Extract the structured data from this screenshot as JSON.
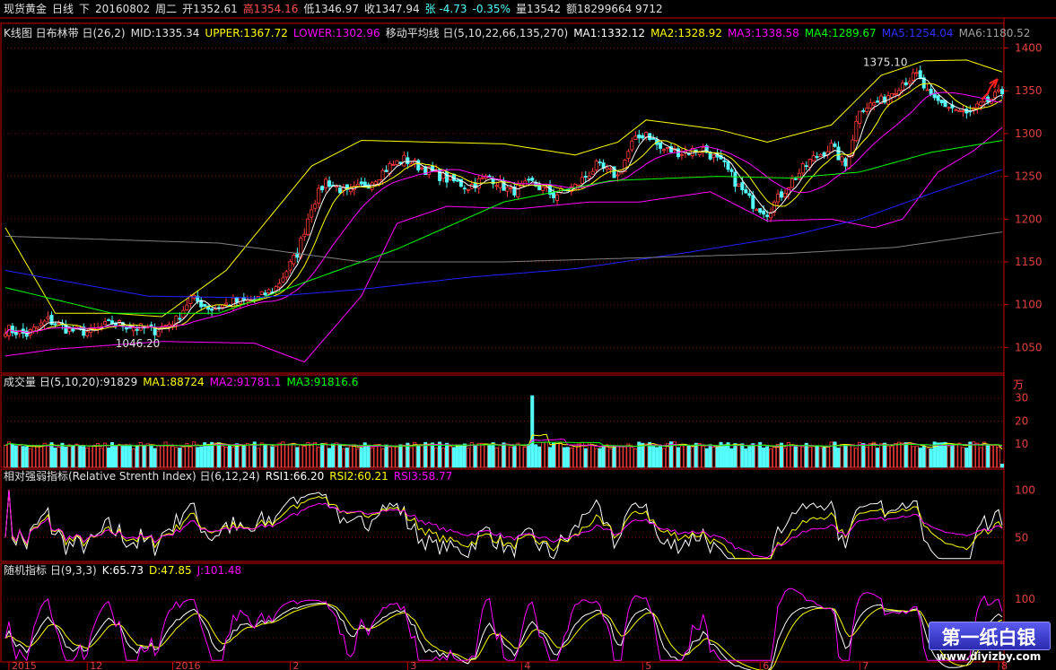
{
  "top_bar": {
    "symbol": "现货黄金",
    "period": "日线",
    "dir": "下",
    "date": "20160802",
    "weekday": "周二",
    "open": "开1352.61",
    "high": "高1354.16",
    "low": "低1346.97",
    "close": "收1347.94",
    "change": "张 -4.73",
    "change_pct": "-0.35%",
    "volume": "量13542",
    "amount": "额18299664 9712"
  },
  "kline_bar": {
    "title": "K线图 日布林带 日(26,2)",
    "mid": "MID:1335.34",
    "upper": "UPPER:1367.72",
    "lower": "LOWER:1302.96",
    "ma_title": "移动平均线 日(5,10,22,66,135,270)",
    "ma1": "MA1:1332.12",
    "ma2": "MA2:1328.92",
    "ma3": "MA3:1338.58",
    "ma4": "MA4:1289.67",
    "ma5": "MA5:1254.04",
    "ma6": "MA6:1180.52"
  },
  "vol_bar": {
    "title": "成交量 日(5,10,20)",
    "value": ":91829",
    "ma1": "MA1:88724",
    "ma2": "MA2:91781.1",
    "ma3": "MA3:91816.6",
    "unit": "万"
  },
  "rsi_bar": {
    "title": "相对强弱指标(Relative Strenth Index) 日(6,12,24)",
    "rsi1": "RSI1:66.20",
    "rsi2": "RSI2:60.21",
    "rsi3": "RSI3:58.77"
  },
  "kdj_bar": {
    "title": "随机指标 日(9,3,3)",
    "k": "K:65.73",
    "d": "D:47.85",
    "j": "J:101.48"
  },
  "watermark": {
    "line1": "第一纸白银",
    "line2": "www.diyizby.com"
  },
  "colors": {
    "up": "#ff3b3b",
    "down": "#54fcfc",
    "grid": "#8b0000",
    "axis": "#c80000",
    "ma1": "#ffffff",
    "ma2": "#ffff00",
    "ma3": "#ff00ff",
    "ma4": "#00ff00",
    "ma5": "#2020ff",
    "ma6": "#808080",
    "boll": "#ffff00"
  },
  "chart_data": [
    {
      "type": "candlestick",
      "title": "",
      "ylim": [
        1020,
        1410
      ],
      "yticks": [
        1400,
        1350,
        1300,
        1250,
        1200,
        1150,
        1100,
        1050
      ],
      "xticks": [
        "2015",
        "12",
        "2016",
        "2",
        "3",
        "4",
        "5",
        "6",
        "7",
        "8"
      ],
      "annotations": [
        {
          "text": "1375.10",
          "y": 1375.1
        },
        {
          "text": "1046.20",
          "y": 1046.2
        }
      ],
      "anchors": [
        [
          0,
          1072
        ],
        [
          6,
          1065
        ],
        [
          12,
          1082
        ],
        [
          18,
          1070
        ],
        [
          24,
          1068
        ],
        [
          30,
          1079
        ],
        [
          36,
          1074
        ],
        [
          42,
          1070
        ],
        [
          48,
          1082
        ],
        [
          52,
          1108
        ],
        [
          58,
          1095
        ],
        [
          64,
          1103
        ],
        [
          70,
          1105
        ],
        [
          76,
          1120
        ],
        [
          82,
          1160
        ],
        [
          86,
          1215
        ],
        [
          90,
          1245
        ],
        [
          96,
          1230
        ],
        [
          102,
          1242
        ],
        [
          108,
          1262
        ],
        [
          112,
          1270
        ],
        [
          118,
          1258
        ],
        [
          124,
          1247
        ],
        [
          130,
          1238
        ],
        [
          136,
          1250
        ],
        [
          142,
          1232
        ],
        [
          148,
          1242
        ],
        [
          154,
          1228
        ],
        [
          160,
          1238
        ],
        [
          166,
          1262
        ],
        [
          172,
          1250
        ],
        [
          176,
          1288
        ],
        [
          180,
          1302
        ],
        [
          184,
          1282
        ],
        [
          190,
          1278
        ],
        [
          196,
          1282
        ],
        [
          202,
          1262
        ],
        [
          206,
          1238
        ],
        [
          210,
          1218
        ],
        [
          214,
          1208
        ],
        [
          220,
          1240
        ],
        [
          226,
          1268
        ],
        [
          232,
          1285
        ],
        [
          236,
          1262
        ],
        [
          240,
          1330
        ],
        [
          246,
          1338
        ],
        [
          252,
          1360
        ],
        [
          256,
          1368
        ],
        [
          260,
          1340
        ],
        [
          266,
          1330
        ],
        [
          270,
          1322
        ],
        [
          276,
          1338
        ],
        [
          280,
          1348
        ]
      ],
      "bands": {
        "upper": [
          [
            0,
            1190
          ],
          [
            14,
            1090
          ],
          [
            30,
            1090
          ],
          [
            44,
            1086
          ],
          [
            62,
            1140
          ],
          [
            86,
            1262
          ],
          [
            100,
            1292
          ],
          [
            120,
            1290
          ],
          [
            140,
            1288
          ],
          [
            160,
            1275
          ],
          [
            172,
            1290
          ],
          [
            180,
            1316
          ],
          [
            200,
            1305
          ],
          [
            214,
            1290
          ],
          [
            232,
            1310
          ],
          [
            246,
            1368
          ],
          [
            258,
            1385
          ],
          [
            270,
            1386
          ],
          [
            280,
            1372
          ]
        ],
        "lower": [
          [
            0,
            1040
          ],
          [
            14,
            1048
          ],
          [
            44,
            1057
          ],
          [
            70,
            1055
          ],
          [
            84,
            1033
          ],
          [
            100,
            1110
          ],
          [
            110,
            1195
          ],
          [
            124,
            1215
          ],
          [
            144,
            1212
          ],
          [
            164,
            1220
          ],
          [
            178,
            1220
          ],
          [
            198,
            1232
          ],
          [
            214,
            1198
          ],
          [
            232,
            1200
          ],
          [
            244,
            1190
          ],
          [
            252,
            1200
          ],
          [
            262,
            1255
          ],
          [
            272,
            1280
          ],
          [
            280,
            1307
          ]
        ]
      },
      "ma_lines": [
        {
          "name": "MA4",
          "points": [
            [
              0,
              1120
            ],
            [
              30,
              1090
            ],
            [
              60,
              1090
            ],
            [
              90,
              1135
            ],
            [
              110,
              1165
            ],
            [
              140,
              1220
            ],
            [
              170,
              1245
            ],
            [
              200,
              1250
            ],
            [
              220,
              1248
            ],
            [
              240,
              1255
            ],
            [
              260,
              1278
            ],
            [
              280,
              1292
            ]
          ]
        },
        {
          "name": "MA5",
          "points": [
            [
              0,
              1140
            ],
            [
              40,
              1110
            ],
            [
              70,
              1108
            ],
            [
              100,
              1118
            ],
            [
              130,
              1132
            ],
            [
              160,
              1142
            ],
            [
              190,
              1160
            ],
            [
              220,
              1180
            ],
            [
              240,
              1200
            ],
            [
              260,
              1230
            ],
            [
              280,
              1258
            ]
          ]
        },
        {
          "name": "MA6",
          "points": [
            [
              0,
              1180
            ],
            [
              60,
              1172
            ],
            [
              100,
              1150
            ],
            [
              140,
              1150
            ],
            [
              180,
              1155
            ],
            [
              220,
              1160
            ],
            [
              250,
              1167
            ],
            [
              280,
              1185
            ]
          ]
        }
      ]
    },
    {
      "type": "bar",
      "title": "",
      "unit": "万",
      "ylim": [
        0,
        33
      ],
      "yticks": [
        30,
        20,
        10
      ],
      "spike": {
        "index": 148,
        "value": 31
      }
    },
    {
      "type": "line",
      "title": "",
      "ylim": [
        25,
        105
      ],
      "yticks": [
        100,
        50
      ],
      "series_names": [
        "RSI1",
        "RSI2",
        "RSI3"
      ]
    },
    {
      "type": "line",
      "title": "",
      "ylim": [
        20,
        125
      ],
      "yticks": [
        100,
        50
      ],
      "series_names": [
        "K",
        "D",
        "J"
      ]
    }
  ]
}
